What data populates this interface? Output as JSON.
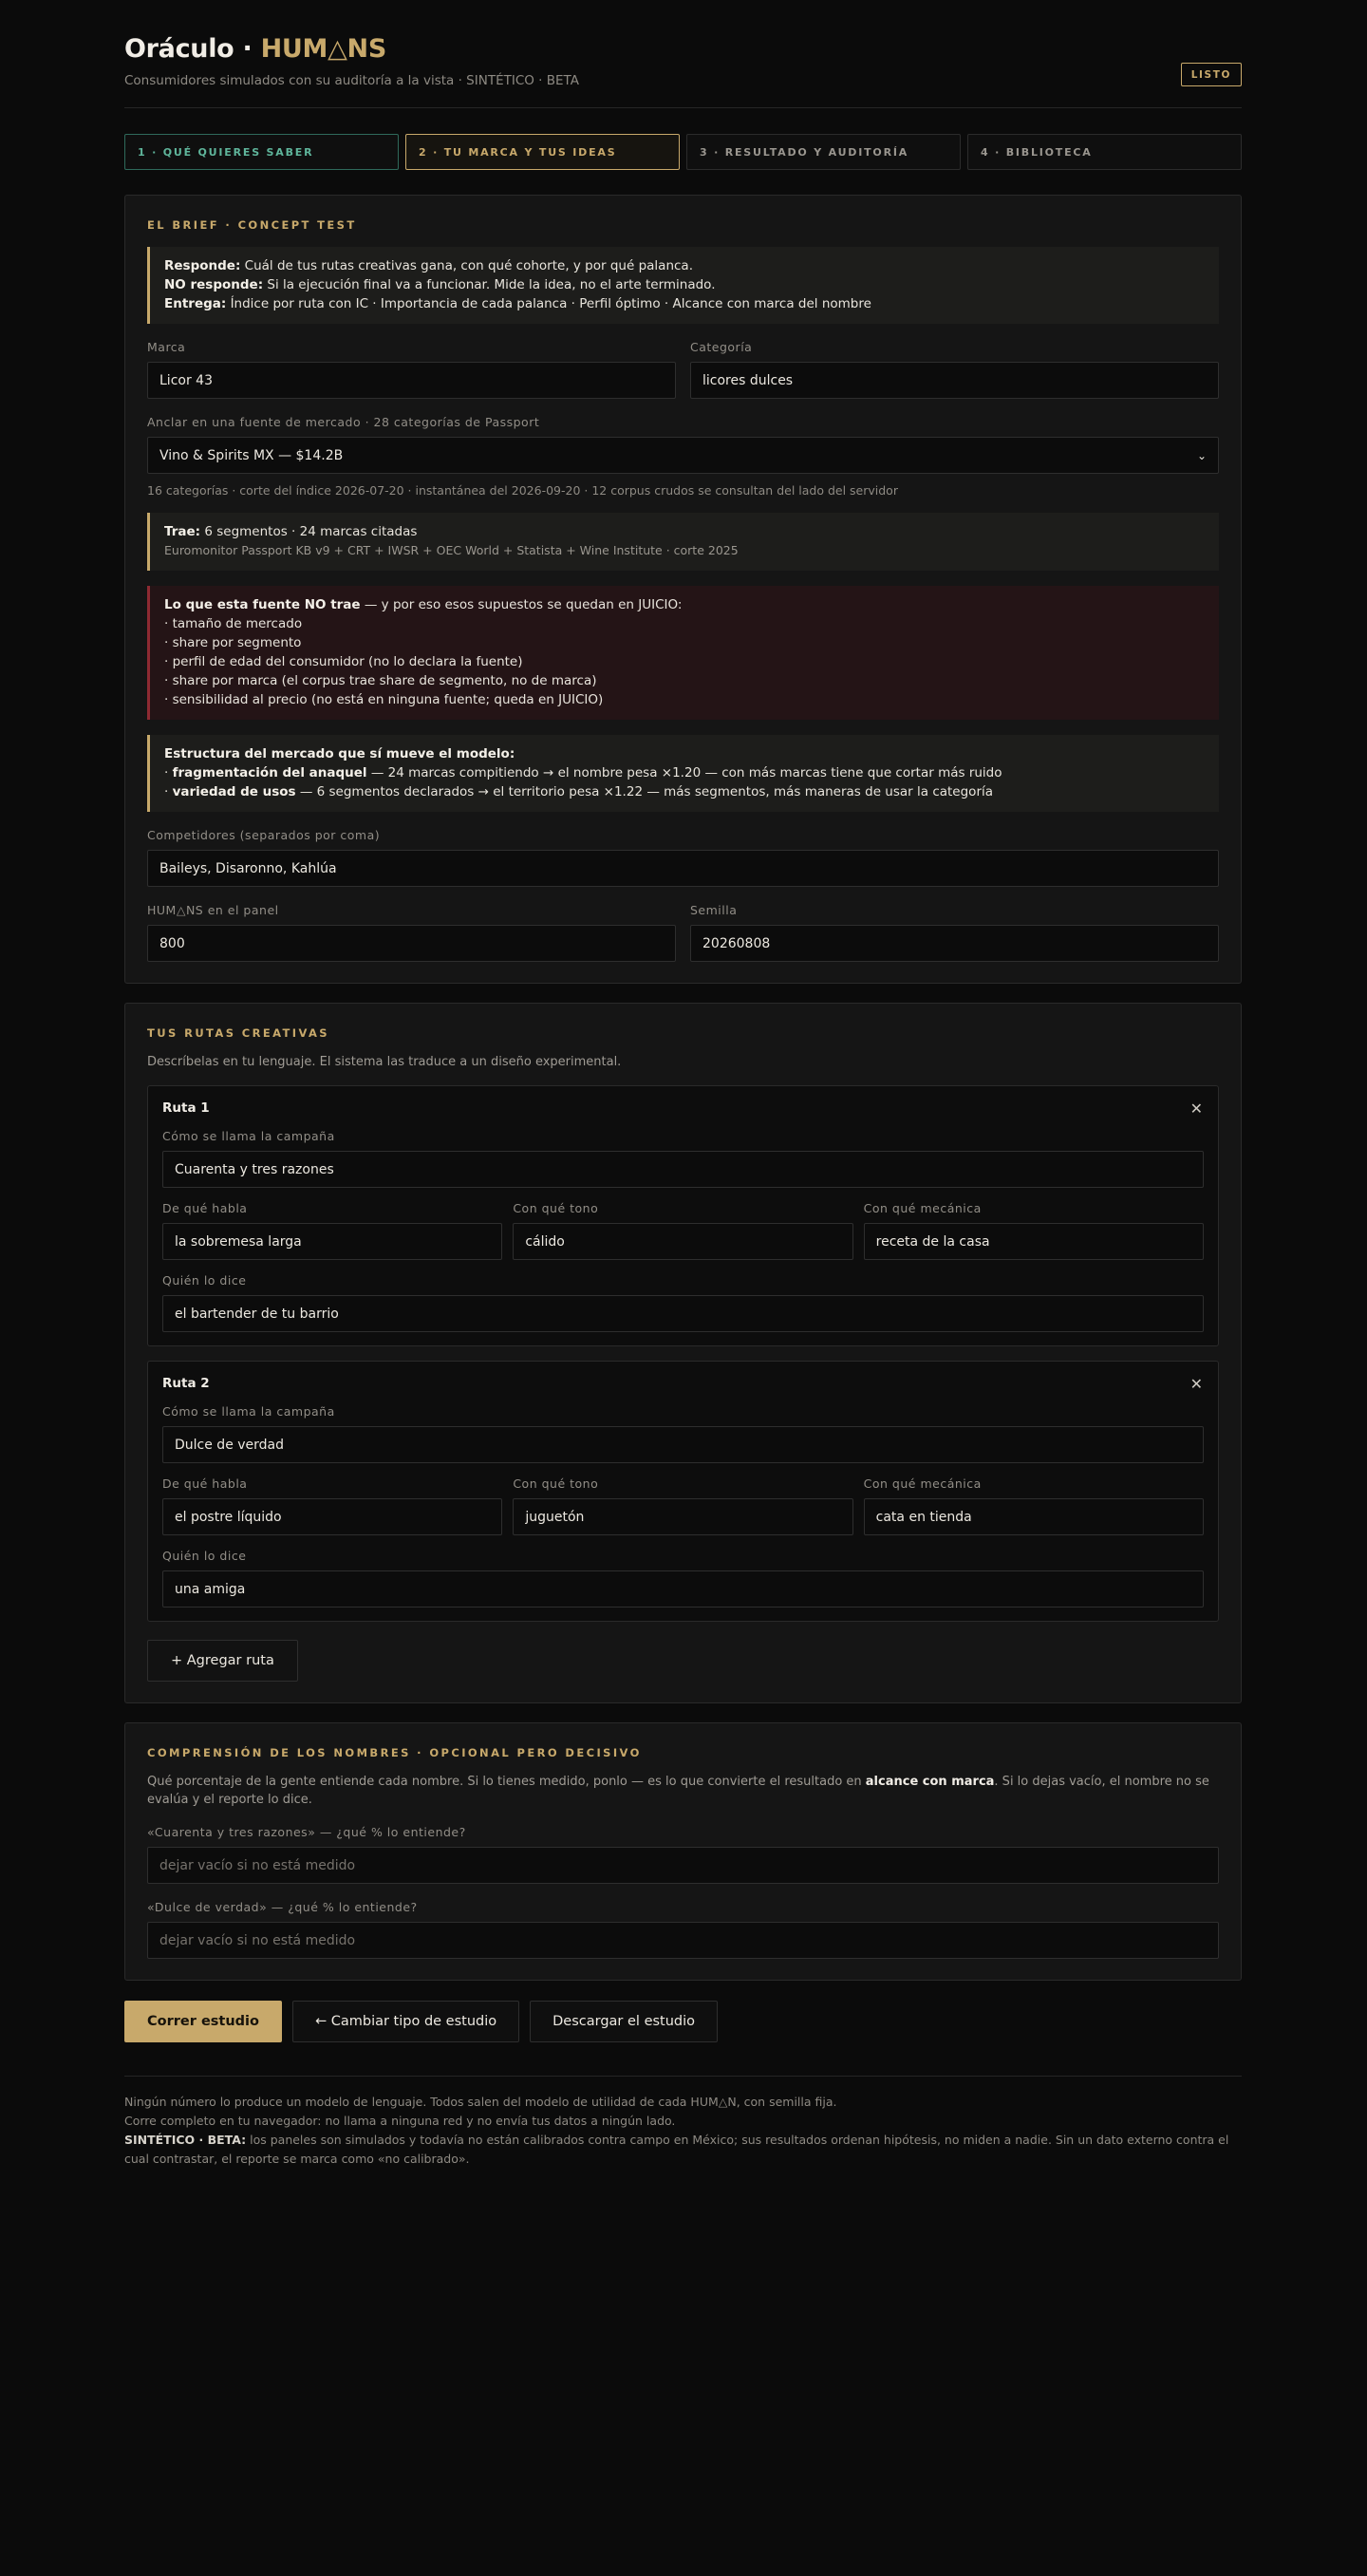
{
  "header": {
    "title_main": "Oráculo · ",
    "title_brand": "HUM△NS",
    "subtitle": "Consumidores simulados con su auditoría a la vista · SINTÉTICO · BETA",
    "status": "LISTO"
  },
  "tabs": [
    {
      "label": "1 · QUÉ QUIERES SABER",
      "state": "done"
    },
    {
      "label": "2 · TU MARCA Y TUS IDEAS",
      "state": "active"
    },
    {
      "label": "3 · RESULTADO Y AUDITORÍA",
      "state": "idle"
    },
    {
      "label": "4 · BIBLIOTECA",
      "state": "idle"
    }
  ],
  "brief": {
    "title": "EL BRIEF · CONCEPT TEST",
    "responde_label": "Responde:",
    "responde": " Cuál de tus rutas creativas gana, con qué cohorte, y por qué palanca.",
    "no_responde_label": "NO responde:",
    "no_responde": " Si la ejecución final va a funcionar. Mide la idea, no el arte terminado.",
    "entrega_label": "Entrega:",
    "entrega": " Índice por ruta con IC · Importancia de cada palanca · Perfil óptimo · Alcance con marca del nombre",
    "marca_label": "Marca",
    "marca_value": "Licor 43",
    "categoria_label": "Categoría",
    "categoria_value": "licores dulces",
    "anchor_label": "Anclar en una fuente de mercado · 28 categorías de Passport",
    "anchor_value": "Vino & Spirits MX — $14.2B",
    "anchor_hint": "16 categorías · corte del índice 2026-07-20 · instantánea del 2026-09-20 · 12 corpus crudos se consultan del lado del servidor",
    "trae_label": "Trae:",
    "trae": " 6 segmentos · 24 marcas citadas",
    "trae_sources": "Euromonitor Passport KB v9 + CRT + IWSR + OEC World + Statista + Wine Institute · corte 2025",
    "no_trae_label": "Lo que esta fuente NO trae",
    "no_trae_rest": " — y por eso esos supuestos se quedan en JUICIO:",
    "no_trae_items": [
      "· tamaño de mercado",
      "· share por segmento",
      "· perfil de edad del consumidor (no lo declara la fuente)",
      "· share por marca (el corpus trae share de segmento, no de marca)",
      "· sensibilidad al precio (no está en ninguna fuente; queda en JUICIO)"
    ],
    "estructura_label": "Estructura del mercado que sí mueve el modelo:",
    "estructura_1_label": "fragmentación del anaquel",
    "estructura_1": " — 24 marcas compitiendo → el nombre pesa ×1.20 — con más marcas tiene que cortar más ruido",
    "estructura_2_label": "variedad de usos",
    "estructura_2": " — 6 segmentos declarados → el territorio pesa ×1.22 — más segmentos, más maneras de usar la categoría",
    "competidores_label": "Competidores (separados por coma)",
    "competidores_value": "Baileys, Disaronno, Kahlúa",
    "panel_label": "HUM△NS en el panel",
    "panel_value": "800",
    "semilla_label": "Semilla",
    "semilla_value": "20260808"
  },
  "routes": {
    "title": "TUS RUTAS CREATIVAS",
    "desc": "Descríbelas en tu lenguaje. El sistema las traduce a un diseño experimental.",
    "name_label": "Cómo se llama la campaña",
    "habla_label": "De qué habla",
    "tono_label": "Con qué tono",
    "mecanica_label": "Con qué mecánica",
    "quien_label": "Quién lo dice",
    "close_glyph": "✕",
    "items": [
      {
        "title": "Ruta 1",
        "name": "Cuarenta y tres razones",
        "habla": "la sobremesa larga",
        "tono": "cálido",
        "mecanica": "receta de la casa",
        "quien": "el bartender de tu barrio"
      },
      {
        "title": "Ruta 2",
        "name": "Dulce de verdad",
        "habla": "el postre líquido",
        "tono": "juguetón",
        "mecanica": "cata en tienda",
        "quien": "una amiga"
      }
    ],
    "add_label": "+ Agregar ruta"
  },
  "comprehension": {
    "title": "COMPRENSIÓN DE LOS NOMBRES · OPCIONAL PERO DECISIVO",
    "desc_a": "Qué porcentaje de la gente entiende cada nombre. Si lo tienes medido, ponlo — es lo que convierte el resultado en ",
    "desc_b": "alcance con marca",
    "desc_c": ". Si lo dejas vacío, el nombre no se evalúa y el reporte lo dice.",
    "q1_label": "«Cuarenta y tres razones» — ¿qué % lo entiende?",
    "q2_label": "«Dulce de verdad» — ¿qué % lo entiende?",
    "placeholder": "dejar vacío si no está medido"
  },
  "actions": {
    "run": "Correr estudio",
    "change": "← Cambiar tipo de estudio",
    "download": "Descargar el estudio"
  },
  "footer": {
    "line1": "Ningún número lo produce un modelo de lenguaje. Todos salen del modelo de utilidad de cada HUM△N, con semilla fija.",
    "line2": "Corre completo en tu navegador: no llama a ninguna red y no envía tus datos a ningún lado.",
    "line3_label": "SINTÉTICO · BETA:",
    "line3": " los paneles son simulados y todavía no están calibrados contra campo en México; sus resultados ordenan hipótesis, no miden a nadie. Sin un dato externo contra el cual contrastar, el reporte se marca como «no calibrado»."
  }
}
